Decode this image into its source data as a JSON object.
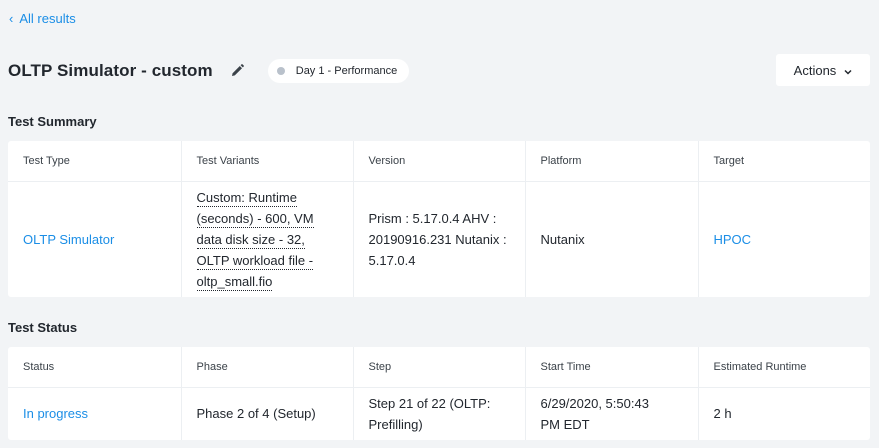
{
  "nav": {
    "back_label": "All results"
  },
  "header": {
    "title": "OLTP Simulator - custom",
    "tag": "Day 1 - Performance",
    "actions_label": "Actions"
  },
  "summary": {
    "title": "Test Summary",
    "columns": [
      "Test Type",
      "Test Variants",
      "Version",
      "Platform",
      "Target"
    ],
    "row": {
      "test_type": "OLTP Simulator",
      "variants": [
        "Custom: Runtime",
        "(seconds) - 600, VM",
        "data disk size - 32,",
        "OLTP workload file -",
        "oltp_small.fio"
      ],
      "version": [
        "Prism : 5.17.0.4 AHV :",
        "20190916.231 Nutanix :",
        "5.17.0.4"
      ],
      "platform": "Nutanix",
      "target": "HPOC"
    }
  },
  "status": {
    "title": "Test Status",
    "columns": [
      "Status",
      "Phase",
      "Step",
      "Start Time",
      "Estimated Runtime"
    ],
    "row": {
      "status": "In progress",
      "phase": "Phase 2 of 4 (Setup)",
      "step": [
        "Step 21 of 22 (OLTP:",
        "Prefilling)"
      ],
      "start_time": [
        "6/29/2020, 5:50:43",
        "PM EDT"
      ],
      "runtime": "2 h"
    }
  },
  "colors": {
    "accent": "#1b8ee6",
    "background": "#f2f4f6",
    "card": "#ffffff",
    "text": "#22272e"
  },
  "icons": {
    "back": "chevron-left-icon",
    "edit": "pencil-icon",
    "status_dot": "dot-icon",
    "actions": "chevron-down-icon"
  }
}
